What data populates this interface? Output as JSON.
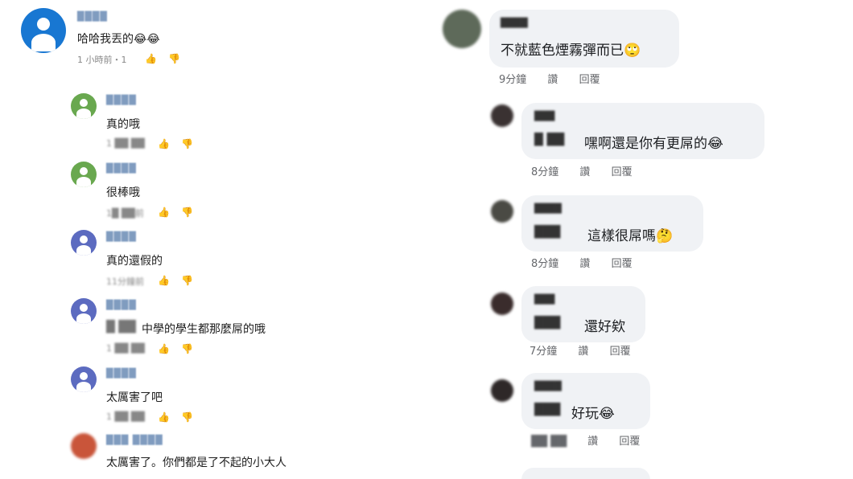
{
  "left": {
    "comments": [
      {
        "name": "████",
        "text": "哈哈我丟的😂😂",
        "meta": "1 小時前・1",
        "avatar_color": "#1877d2",
        "reply": false
      },
      {
        "name": "████",
        "text": "真的哦",
        "meta": "1 ██ ██",
        "avatar_color": "#69a84f",
        "reply": true
      },
      {
        "name": "████",
        "text": "很棒哦",
        "meta": "1█ ██前",
        "avatar_color": "#69a84f",
        "reply": true
      },
      {
        "name": "████",
        "text": "真的還假的",
        "meta": "11分鐘前",
        "avatar_color": "#5c6bc0",
        "reply": true
      },
      {
        "name": "████",
        "text": "中學的學生都那麼屌的哦",
        "meta": "1 ██ ██",
        "avatar_color": "#5c6bc0",
        "reply": true,
        "blur_prefix": "█ ██"
      },
      {
        "name": "████",
        "text": "太厲害了吧",
        "meta": "1 ██ ██",
        "avatar_color": "#5c6bc0",
        "reply": true
      },
      {
        "name": "███ ████",
        "text": "太厲害了。你們都是了不起的小大人",
        "meta": "",
        "avatar_color": "#c9553a",
        "reply": true
      }
    ]
  },
  "right": {
    "comments": [
      {
        "name": "████",
        "mention": "",
        "text": "不就藍色煙霧彈而已🙄",
        "time": "9分鐘",
        "like": "讚",
        "reply": "回覆",
        "avatar_color": "#5e6a5a"
      },
      {
        "name": "███",
        "mention": "█ ██",
        "text": "嘿啊還是你有更屌的😂",
        "time": "8分鐘",
        "like": "讚",
        "reply": "回覆",
        "avatar_color": "#3a3232"
      },
      {
        "name": "████",
        "mention": "███",
        "text": "這樣很屌嗎🤔",
        "time": "8分鐘",
        "like": "讚",
        "reply": "回覆",
        "avatar_color": "#4a4a44"
      },
      {
        "name": "███",
        "mention": "███",
        "text": "還好欸",
        "time": "7分鐘",
        "like": "讚",
        "reply": "回覆",
        "avatar_color": "#3a2c2c"
      },
      {
        "name": "████",
        "mention": "███",
        "text": "好玩😂",
        "time": "██ ██",
        "like": "讚",
        "reply": "回覆",
        "avatar_color": "#2e2828"
      }
    ]
  }
}
